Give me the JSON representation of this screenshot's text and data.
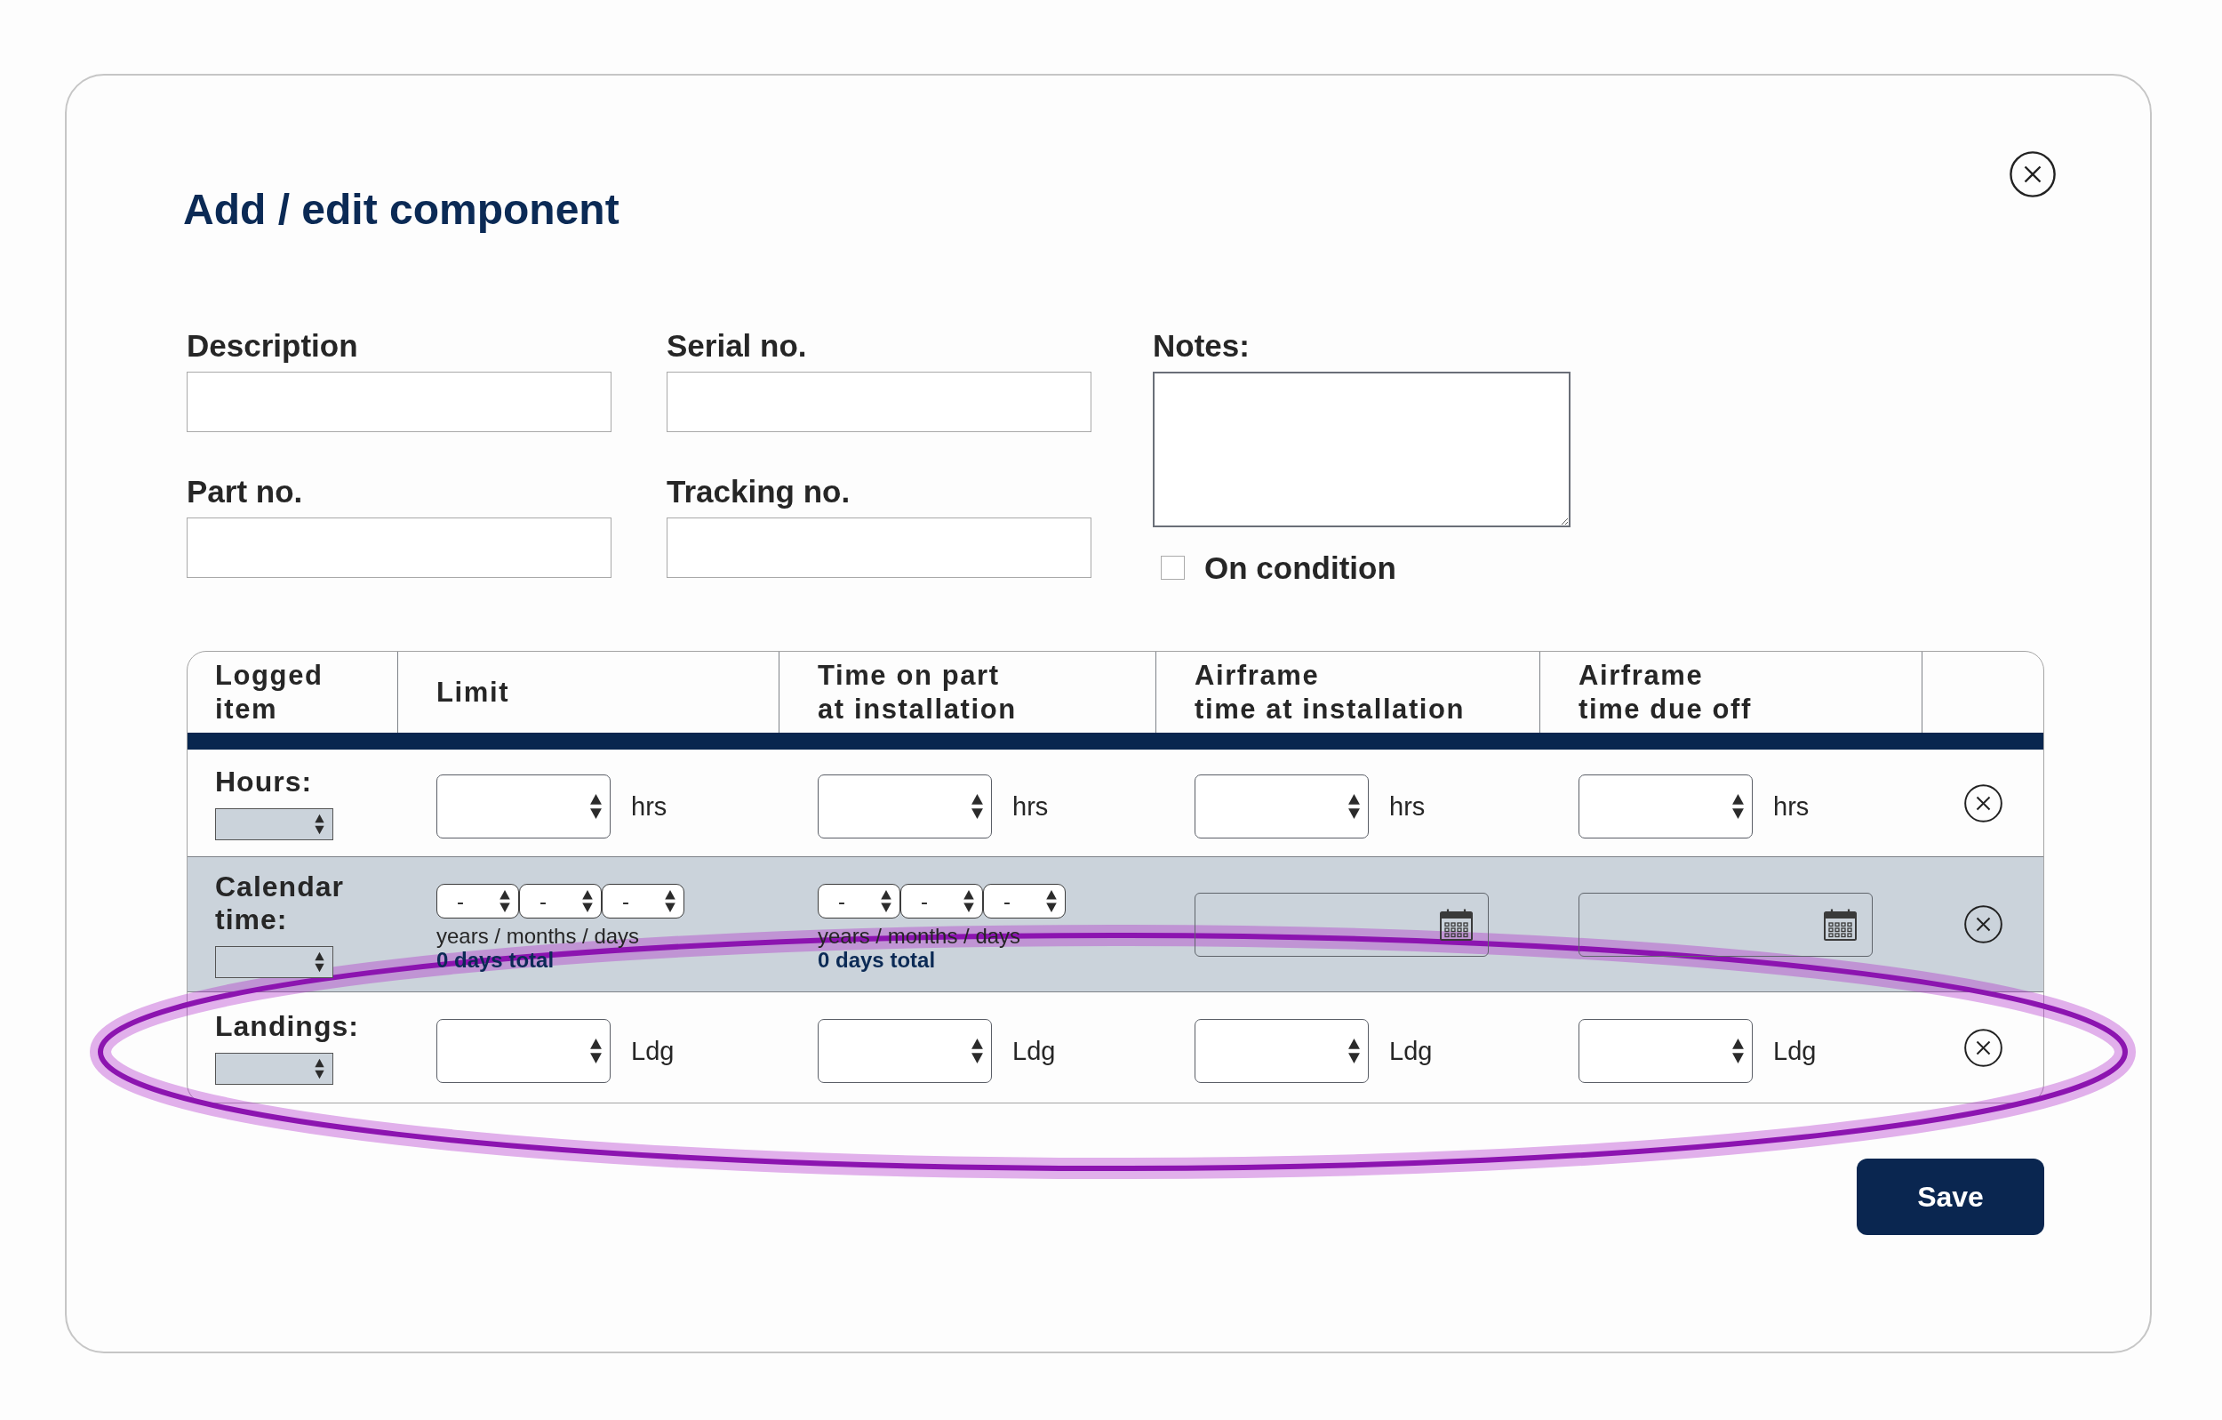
{
  "dialog": {
    "title": "Add / edit component"
  },
  "fields": [
    {
      "label": "Description"
    },
    {
      "label": "Serial no."
    },
    {
      "label": "Part no."
    },
    {
      "label": "Tracking no."
    }
  ],
  "notes": {
    "label": "Notes:"
  },
  "on_condition": {
    "label": "On condition",
    "checked": false
  },
  "table": {
    "columns": [
      "Logged\nitem",
      "Limit",
      "Time on part\nat installation",
      "Airframe\ntime at installation",
      "Airframe\ntime due off"
    ],
    "rows": [
      {
        "kind": "number",
        "highlighted": false,
        "cells": [
          {
            "kind": "item",
            "label": "Hours:"
          },
          {
            "kind": "number",
            "unit": "hrs"
          },
          {
            "kind": "number",
            "unit": "hrs"
          },
          {
            "kind": "number",
            "unit": "hrs"
          },
          {
            "kind": "number",
            "unit": "hrs"
          }
        ]
      },
      {
        "kind": "calendar",
        "highlighted": false,
        "cells": [
          {
            "kind": "item",
            "label": "Calendar time:"
          },
          {
            "kind": "duration",
            "parts": [
              "-",
              "-",
              "-"
            ],
            "caption": "years / months / days",
            "total": "0 days total"
          },
          {
            "kind": "duration",
            "parts": [
              "-",
              "-",
              "-"
            ],
            "caption": "years / months / days",
            "total": "0 days total"
          },
          {
            "kind": "date"
          },
          {
            "kind": "date"
          }
        ]
      },
      {
        "kind": "number",
        "highlighted": true,
        "cells": [
          {
            "kind": "item",
            "label": "Landings:"
          },
          {
            "kind": "number",
            "unit": "Ldg"
          },
          {
            "kind": "number",
            "unit": "Ldg"
          },
          {
            "kind": "number",
            "unit": "Ldg"
          },
          {
            "kind": "number",
            "unit": "Ldg"
          }
        ]
      }
    ]
  },
  "save_button": "Save"
}
